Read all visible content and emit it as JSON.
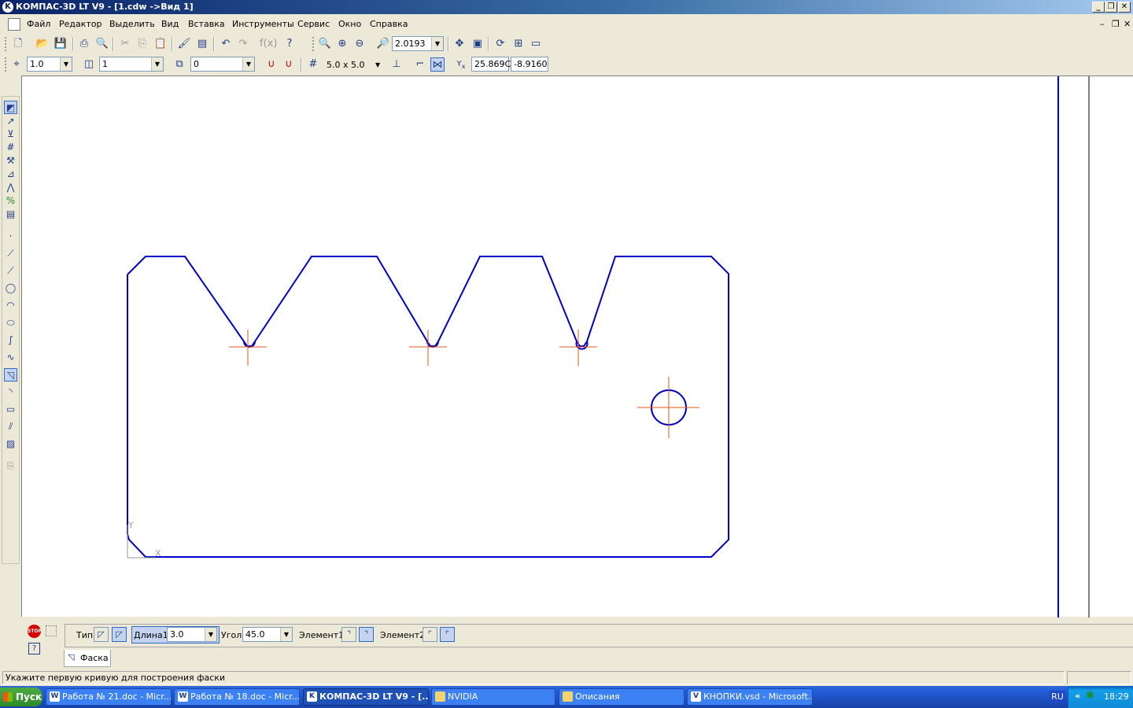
{
  "window": {
    "title": "КОМПАС-3D LT V9 - [1.cdw ->Вид 1]",
    "minimize": "_",
    "restore": "❐",
    "close": "✕"
  },
  "menu": {
    "items": [
      "Файл",
      "Редактор",
      "Выделить",
      "Вид",
      "Вставка",
      "Инструменты",
      "Сервис",
      "Окно",
      "Справка"
    ]
  },
  "toolbar1": {
    "zoom_value": "2.0193"
  },
  "toolbar2": {
    "step_value": "1.0",
    "layer_value": "1",
    "style_value": "0",
    "grid_value": "5.0 x 5.0",
    "coord_x": "25.869С",
    "coord_y": "-8.9160"
  },
  "canvas": {
    "axis_y_label": "Y",
    "axis_x_label": "X",
    "line_color": "#0000c8",
    "center_mark_color": "#e05a1a"
  },
  "property_panel": {
    "type_label": "Тип",
    "length_label": "Длина1",
    "length_value": "3.0",
    "angle_label": "Угол",
    "angle_value": "45.0",
    "element1_label": "Элемент1",
    "element2_label": "Элемент2",
    "tab_label": "Фаска",
    "stop_label": "STOP",
    "help_label": "?"
  },
  "status": {
    "message": "Укажите первую кривую для построения фаски"
  },
  "taskbar": {
    "start_label": "Пуск",
    "tasks": [
      {
        "label": "Работа № 21.doc - Micr...",
        "icon": "W"
      },
      {
        "label": "Работа № 18.doc - Micr...",
        "icon": "W"
      },
      {
        "label": "КОМПАС-3D LT V9 - [...",
        "icon": "K"
      },
      {
        "label": "NVIDIA",
        "icon": "folder-icon"
      },
      {
        "label": "Описания",
        "icon": "folder-icon"
      },
      {
        "label": "КНОПКИ.vsd - Microsoft...",
        "icon": "V"
      }
    ],
    "language": "RU",
    "tray_arrows": "«",
    "clock": "18:29"
  }
}
